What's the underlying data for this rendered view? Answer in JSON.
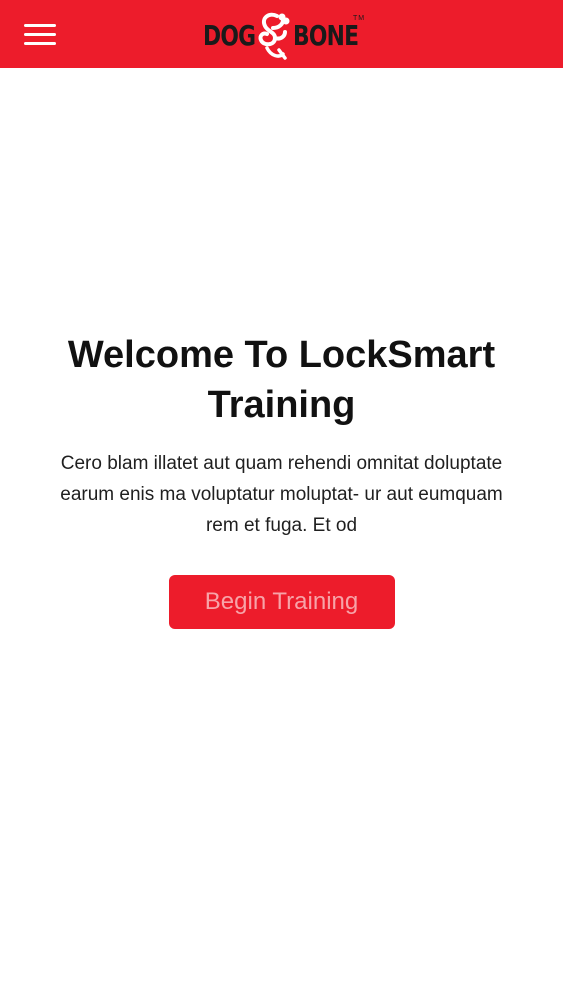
{
  "header": {
    "logo": {
      "left_word": "DOG",
      "right_word": "BONE",
      "mark": "TM"
    },
    "menu_icon": "hamburger-icon"
  },
  "main": {
    "title": "Welcome To LockSmart Training",
    "description": "Cero blam illatet aut quam rehendi omnitat doluptate earum enis ma voluptatur moluptat- ur aut eumquam rem et fuga. Et od",
    "cta_label": "Begin Training"
  },
  "colors": {
    "brand_red": "#ed1c2b",
    "button_text": "#f7a3a8",
    "logo_text": "#1a1a1a",
    "body_text": "#1f1f1f"
  }
}
